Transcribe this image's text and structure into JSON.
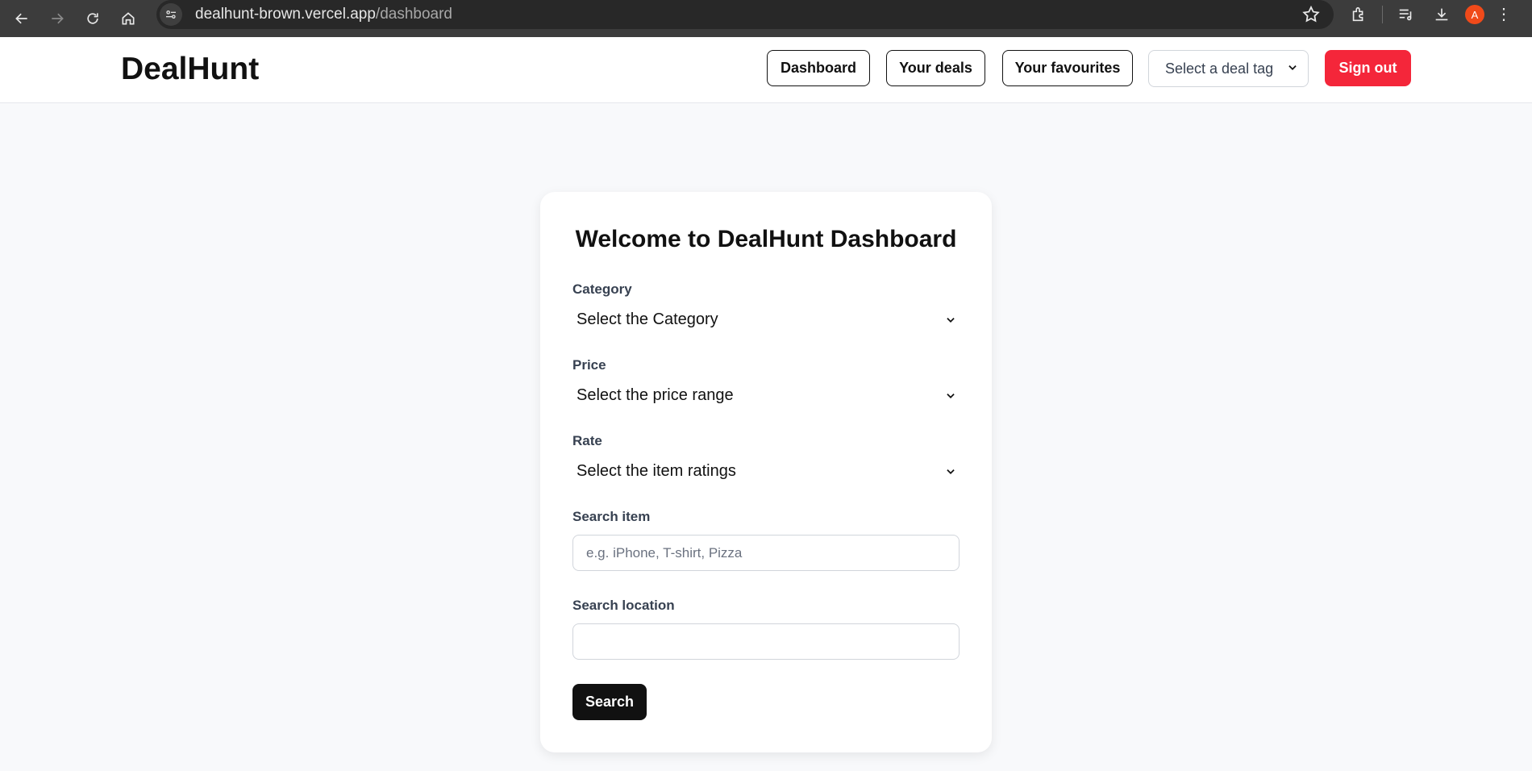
{
  "browser": {
    "url_host": "dealhunt-brown.vercel.app",
    "url_path": "/dashboard",
    "profile_initial": "A"
  },
  "navbar": {
    "brand": "DealHunt",
    "dashboard_label": "Dashboard",
    "your_deals_label": "Your deals",
    "your_favourites_label": "Your favourites",
    "deal_tag_select": "Select a deal tag",
    "sign_out_label": "Sign out"
  },
  "card": {
    "title": "Welcome to DealHunt Dashboard",
    "category_label": "Category",
    "category_value": "Select the Category",
    "price_label": "Price",
    "price_value": "Select the price range",
    "rate_label": "Rate",
    "rate_value": "Select the item ratings",
    "search_item_label": "Search item",
    "search_item_placeholder": "e.g. iPhone, T-shirt, Pizza",
    "search_location_label": "Search location",
    "search_location_value": "",
    "search_button": "Search"
  },
  "colors": {
    "chrome_bg": "#3c3c3c",
    "sign_out_bg": "#f4263a",
    "search_btn_bg": "#111111",
    "page_bg": "#f8f9fb"
  }
}
